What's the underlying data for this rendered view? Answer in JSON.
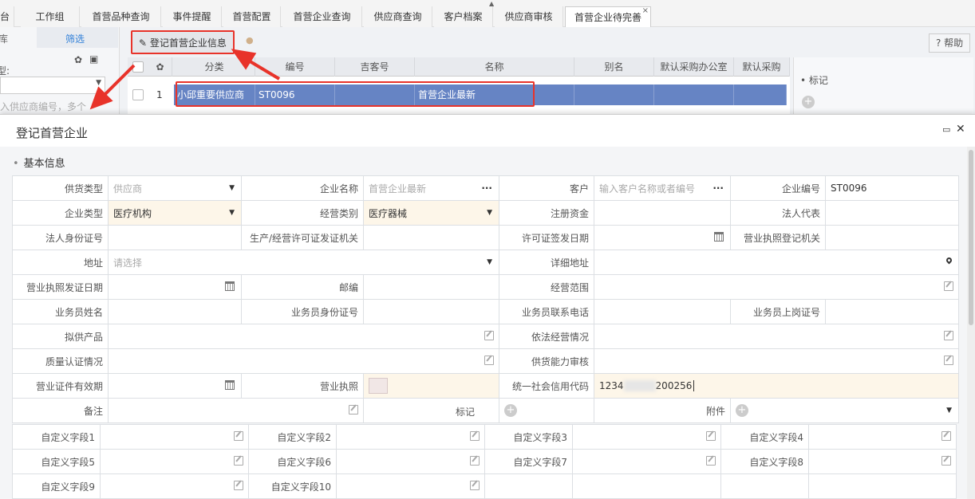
{
  "tabs": [
    {
      "label": "台"
    },
    {
      "label": "工作组"
    },
    {
      "label": "首营品种查询"
    },
    {
      "label": "事件提醒"
    },
    {
      "label": "首营配置"
    },
    {
      "label": "首营企业查询"
    },
    {
      "label": "供应商查询"
    },
    {
      "label": "客户档案"
    },
    {
      "label": "供应商审核"
    },
    {
      "label": "首营企业待完善",
      "close": "×"
    }
  ],
  "left_panel": {
    "tab1": "库",
    "tab2": "筛选",
    "type_label": "型:",
    "input_placeholder": "入供应商编号，多个"
  },
  "toolbar": {
    "register_button": "登记首营企业信息",
    "help": "? 帮助"
  },
  "grid": {
    "columns": [
      "分类",
      "编号",
      "吉客号",
      "名称",
      "别名",
      "默认采购办公室",
      "默认采购"
    ],
    "row": {
      "num": "1",
      "category": "小邱重要供应商",
      "code": "ST0096",
      "jike": "",
      "name": "首营企业最新",
      "alias": ""
    }
  },
  "right_panel": {
    "mark": "• 标记"
  },
  "modal": {
    "title": "登记首营企业",
    "section": "基本信息",
    "fields": {
      "supply_type_label": "供货类型",
      "supply_type_value": "供应商",
      "company_name_label": "企业名称",
      "company_name_value": "首营企业最新",
      "customer_label": "客户",
      "customer_placeholder": "输入客户名称或者编号",
      "company_code_label": "企业编号",
      "company_code_value": "ST0096",
      "company_type_label": "企业类型",
      "company_type_value": "医疗机构",
      "business_cat_label": "经营类别",
      "business_cat_value": "医疗器械",
      "reg_capital_label": "注册资金",
      "legal_rep_label": "法人代表",
      "legal_id_label": "法人身份证号",
      "license_org_label": "生产/经营许可证发证机关",
      "license_date_label": "许可证签发日期",
      "biz_reg_org_label": "营业执照登记机关",
      "address_label": "地址",
      "address_placeholder": "请选择",
      "detail_address_label": "详细地址",
      "biz_license_date_label": "营业执照发证日期",
      "postcode_label": "邮编",
      "biz_scope_label": "经营范围",
      "salesman_name_label": "业务员姓名",
      "salesman_id_label": "业务员身份证号",
      "salesman_phone_label": "业务员联系电话",
      "salesman_cert_label": "业务员上岗证号",
      "products_label": "拟供产品",
      "legal_ops_label": "依法经营情况",
      "quality_label": "质量认证情况",
      "supply_audit_label": "供货能力审核",
      "cert_valid_label": "营业证件有效期",
      "biz_license_label": "营业执照",
      "credit_code_label": "统一社会信用代码",
      "credit_code_prefix": "1234",
      "credit_code_suffix": "200256",
      "remark_label": "备注",
      "mark_label": "标记",
      "attach_label": "附件"
    },
    "custom_fields": [
      "自定义字段1",
      "自定义字段2",
      "自定义字段3",
      "自定义字段4",
      "自定义字段5",
      "自定义字段6",
      "自定义字段7",
      "自定义字段8",
      "自定义字段9",
      "自定义字段10"
    ]
  },
  "colors": {
    "highlight_red": "#e8332a",
    "row_selected": "#6684c4",
    "field_highlight": "#fdf6e9"
  }
}
